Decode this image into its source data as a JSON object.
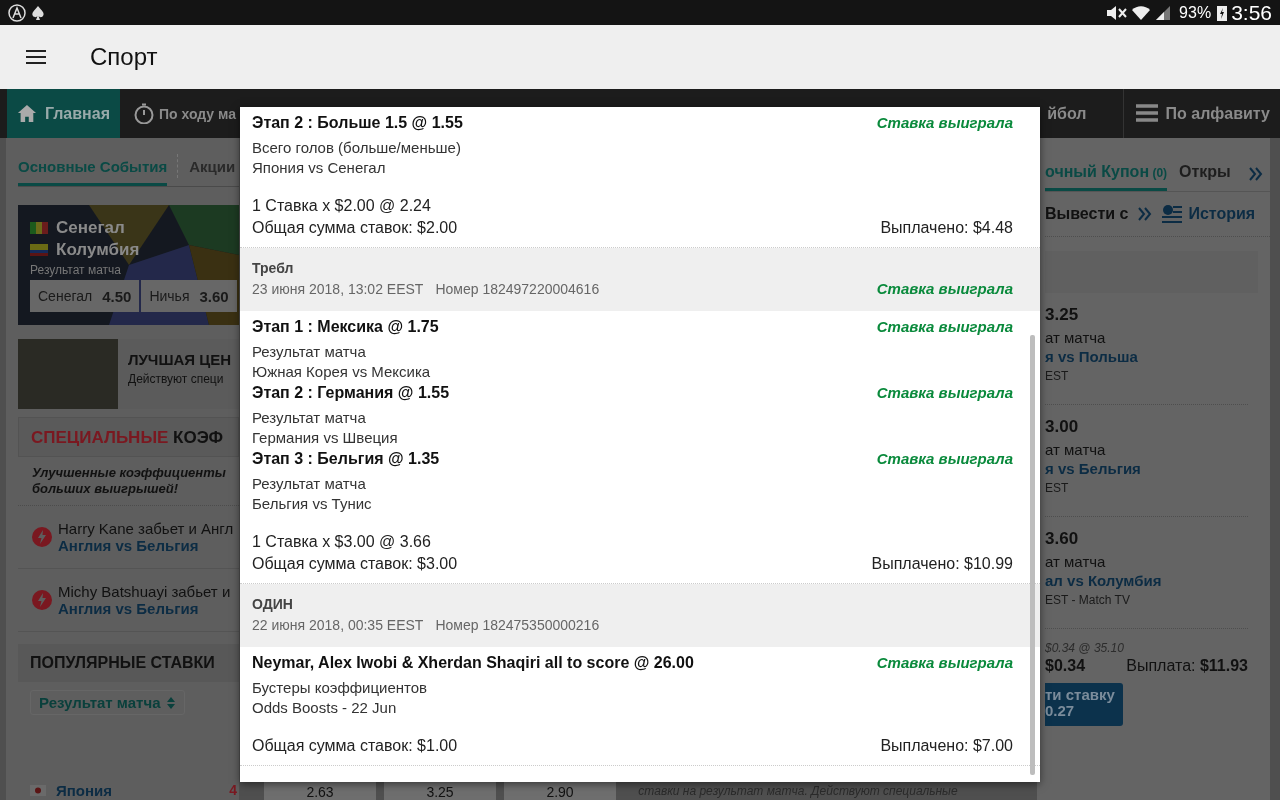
{
  "status_bar": {
    "battery": "93%",
    "time": "3:56"
  },
  "app_bar": {
    "title": "Спорт"
  },
  "nav": [
    {
      "label": "Главная",
      "selected": true
    },
    {
      "label": "По ходу ма",
      "selected": false
    },
    {
      "label": "йбол",
      "selected": false
    },
    {
      "label": "По алфавиту",
      "selected": false
    }
  ],
  "left": {
    "tabs": [
      {
        "label": "Основные События",
        "selected": true
      },
      {
        "label": "Акции",
        "selected": false
      }
    ],
    "match": {
      "team_1": "Сенегал",
      "team_2": "Колумбия",
      "market": "Результат матча",
      "odds": [
        {
          "label": "Сенегал",
          "value": "4.50"
        },
        {
          "label": "Ничья",
          "value": "3.60"
        }
      ]
    },
    "promo": {
      "title": "ЛУЧШАЯ ЦЕН",
      "text": "Действуют специ"
    },
    "special": {
      "title_red": "СПЕЦИАЛЬНЫЕ",
      "title_dark": "КОЭФ",
      "tagline": "Улучшенные коэффициенты больших выигрышей!"
    },
    "boosts": [
      {
        "title": "Harry Kane забьет и Англ",
        "event": "Англия vs Бельгия"
      },
      {
        "title": "Michy Batshuayi забьет и",
        "event": "Англия vs Бельгия"
      }
    ],
    "popular": {
      "title": "ПОПУЛЯРНЫЕ СТАВКИ",
      "dropdown": "Результат матча",
      "team": "Япония",
      "count": "4"
    }
  },
  "middle": {
    "odds": [
      "2.63",
      "3.25",
      "2.90"
    ],
    "note": "ставки на результат матча. Действуют специальные"
  },
  "right": {
    "tabs": [
      {
        "label": "очный Купон",
        "count": "(0)",
        "selected": true
      },
      {
        "label": "Откры",
        "selected": false
      }
    ],
    "links": {
      "cashout": "Вывести с",
      "history": "История"
    },
    "bets": [
      {
        "odds": "3.25",
        "market": "ат матча",
        "event": "я vs Польша",
        "time": "EST"
      },
      {
        "odds": "3.00",
        "market": "ат матча",
        "event": "я vs Бельгия",
        "time": "EST"
      },
      {
        "odds": "3.60",
        "market": "ат матча",
        "event": "ал vs Колумбия",
        "time": "EST - Match TV"
      }
    ],
    "stake_line": "$0.34 @ 35.10",
    "stake": "$0.34",
    "payout_label": "Выплата:",
    "payout": "$11.93",
    "button": [
      "ти ставку",
      "0.27"
    ]
  },
  "modal": {
    "bets": [
      {
        "legs": [
          {
            "title": "Этап 2 : Больше 1.5 @ 1.55",
            "status": "Ставка выиграла",
            "market": "Всего голов (больше/меньше)",
            "event": "Япония vs Сенегал"
          }
        ],
        "stake_line": "1 Ставка x $2.00 @ 2.24",
        "total": "Общая сумма ставок: $2.00",
        "paid": "Выплачено: $4.48"
      },
      {
        "header": {
          "type": "Требл",
          "date": "23 июня 2018, 13:02 EEST",
          "number": "Номер 182497220004616",
          "status": "Ставка выиграла"
        },
        "legs": [
          {
            "title": "Этап 1 : Мексика @ 1.75",
            "status": "Ставка выиграла",
            "market": "Результат матча",
            "event": "Южная Корея vs Мексика"
          },
          {
            "title": "Этап 2 : Германия @ 1.55",
            "status": "Ставка выиграла",
            "market": "Результат матча",
            "event": "Германия vs Швеция"
          },
          {
            "title": "Этап 3 : Бельгия @ 1.35",
            "status": "Ставка выиграла",
            "market": "Результат матча",
            "event": "Бельгия vs Тунис"
          }
        ],
        "stake_line": "1 Ставка x $3.00 @ 3.66",
        "total": "Общая сумма ставок: $3.00",
        "paid": "Выплачено: $10.99"
      },
      {
        "header": {
          "type": "ОДИН",
          "date": "22 июня 2018, 00:35 EEST",
          "number": "Номер 182475350000216"
        },
        "legs": [
          {
            "title": "Neymar, Alex Iwobi & Xherdan Shaqiri all to score @ 26.00",
            "status": "Ставка выиграла",
            "market": "Бустеры коэффициентов",
            "event": "Odds Boosts - 22 Jun"
          }
        ],
        "total": "Общая сумма ставок: $1.00",
        "paid": "Выплачено: $7.00"
      }
    ]
  }
}
